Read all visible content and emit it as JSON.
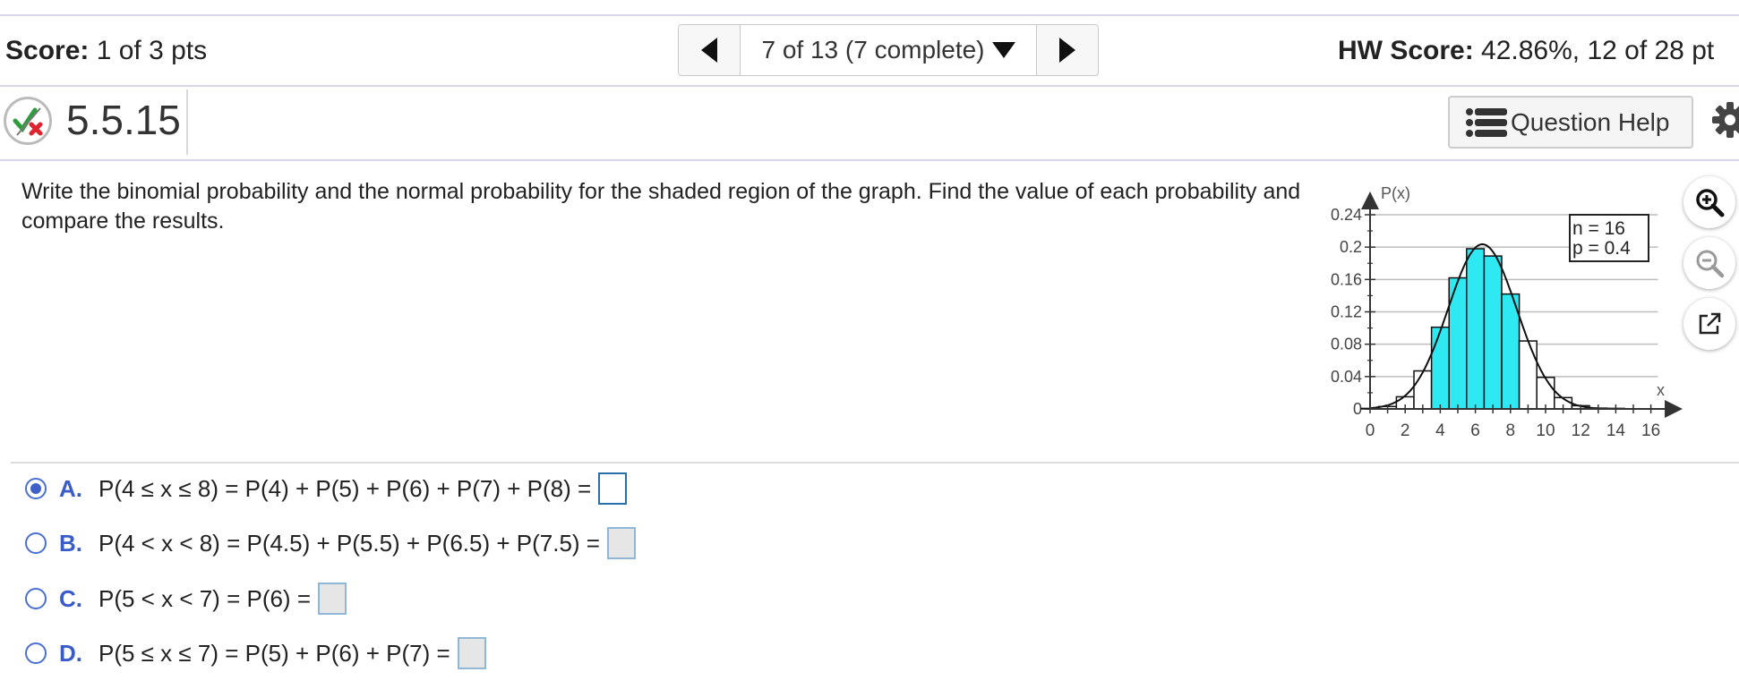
{
  "header": {
    "score_label": "Score:",
    "score_value": " 1 of 3 pts",
    "nav_text": "7 of 13 (7 complete)",
    "hw_label": "HW Score:",
    "hw_value": " 42.86%, 12 of 28 pt"
  },
  "question": {
    "number": "5.5.15",
    "help_label": "Question Help",
    "prompt": "Write the binomial probability and the normal probability for the shaded region of the graph. Find the value of each probability and compare the results."
  },
  "chart_data": {
    "type": "bar",
    "ylabel": "P(x)",
    "xlabel": "x",
    "legend": [
      "n = 16",
      "p = 0.4"
    ],
    "x": [
      0,
      1,
      2,
      3,
      4,
      5,
      6,
      7,
      8,
      9,
      10,
      11,
      12,
      13,
      14,
      15,
      16
    ],
    "values": [
      0.0003,
      0.003,
      0.015,
      0.047,
      0.101,
      0.162,
      0.198,
      0.189,
      0.142,
      0.084,
      0.039,
      0.014,
      0.004,
      0.001,
      0.0001,
      0,
      0
    ],
    "shaded": [
      4,
      5,
      6,
      7,
      8
    ],
    "ylim": [
      0,
      0.24
    ],
    "yticks": [
      "0",
      "0.04",
      "0.08",
      "0.12",
      "0.16",
      "0.2",
      "0.24"
    ],
    "xticks": [
      "0",
      "2",
      "4",
      "6",
      "8",
      "10",
      "12",
      "14",
      "16"
    ],
    "grid": true,
    "curve": "normal",
    "shade_color": "#2ee8f2"
  },
  "options": [
    {
      "letter": "A.",
      "text": "P(4 ≤ x ≤ 8) = P(4) + P(5) + P(6) + P(7) + P(8) =",
      "selected": true
    },
    {
      "letter": "B.",
      "text": "P(4 < x < 8) = P(4.5) + P(5.5) + P(6.5) + P(7.5) =",
      "selected": false
    },
    {
      "letter": "C.",
      "text": "P(5 < x < 7) = P(6) =",
      "selected": false
    },
    {
      "letter": "D.",
      "text": "P(5 ≤ x ≤ 7) = P(5) + P(6) + P(7) =",
      "selected": false
    }
  ],
  "tools": [
    "zoom-in-icon",
    "zoom-out-icon",
    "popout-icon"
  ]
}
